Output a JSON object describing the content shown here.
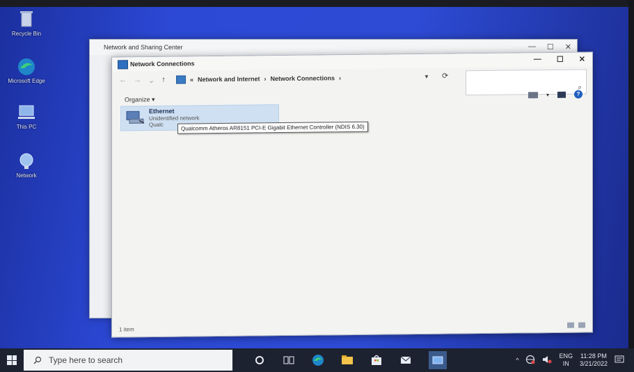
{
  "desktop": {
    "icons": [
      {
        "label": "Recycle Bin"
      },
      {
        "label": "Microsoft Edge"
      },
      {
        "label": "This PC"
      },
      {
        "label": "Network"
      }
    ]
  },
  "back_window": {
    "title": "Network and Sharing Center",
    "controls": [
      "—",
      "☐",
      "✕"
    ]
  },
  "front_window": {
    "title": "Network Connections",
    "controls": [
      "—",
      "☐",
      "✕"
    ],
    "nav": {
      "back": "←",
      "forward": "→",
      "recent": "⌄",
      "up": "↑"
    },
    "address": {
      "prefix": "«",
      "crumbs": [
        "Network and Internet",
        "Network Connections"
      ],
      "separator": "›",
      "trailing": "›"
    },
    "search": {
      "placeholder": "",
      "icon_glyph": "⌕"
    },
    "organize_label": "Organize ▾",
    "help_glyph": "?",
    "item": {
      "title": "Ethernet",
      "status": "Unidentified network",
      "adapter_short": "Qualc",
      "tooltip": "Qualcomm Atheros AR8151 PCI-E Gigabit Ethernet Controller (NDIS 6.30)"
    },
    "status_text": "1 item"
  },
  "taskbar": {
    "search_placeholder": "Type here to search",
    "tray": {
      "lang_top": "ENG",
      "lang_bottom": "IN",
      "time": "11:28 PM",
      "date": "3/21/2022",
      "chevron": "^"
    }
  },
  "colors": {
    "desktop_blue": "#2c49d6",
    "selection_blue": "#cfe0f2",
    "taskbar": "#1d2230"
  }
}
